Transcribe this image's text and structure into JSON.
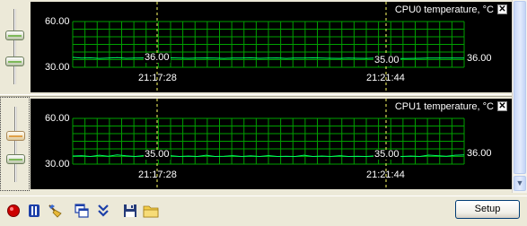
{
  "panels": [
    {
      "title": "CPU0 temperature, °C",
      "y_top": "60.00",
      "y_bottom": "30.00",
      "x_labels": [
        "21:17:28",
        "21:21:44"
      ],
      "cursor_values": [
        "36.00",
        "35.00"
      ],
      "last_value": "36.00",
      "close_glyph": "✕",
      "slider_values": [
        0.2,
        0.75
      ]
    },
    {
      "title": "CPU1 temperature, °C",
      "y_top": "60.00",
      "y_bottom": "30.00",
      "x_labels": [
        "21:17:28",
        "21:21:44"
      ],
      "cursor_values": [
        "35.00",
        "35.00"
      ],
      "last_value": "36.00",
      "close_glyph": "✕",
      "slider_values": [
        0.2,
        0.75
      ]
    }
  ],
  "toolbar": {
    "record_icon": "record-icon",
    "pause_icon": "pause-icon",
    "clear_icon": "broom-icon",
    "window_icon": "windows-icon",
    "collapse_icon": "double-chevron-down-icon",
    "save_icon": "floppy-disk-icon",
    "open_icon": "folder-icon",
    "setup_label": "Setup"
  },
  "colors": {
    "grid": "#00a000",
    "line": "#00ff66",
    "cursor": "#ffff66",
    "background": "#000000",
    "record": "#cc0000",
    "pause": "#1c3fa8"
  },
  "chart_data": [
    {
      "type": "line",
      "title": "CPU0 temperature, °C",
      "ylim": [
        30,
        60
      ],
      "x_tick_labels": [
        "21:17:28",
        "21:21:44"
      ],
      "series": [
        {
          "values": [
            36.5,
            36,
            36.2,
            35.8,
            36,
            36.3,
            35.9,
            36,
            36.1,
            35.8,
            36,
            36.2,
            36,
            35.9,
            36,
            36.1,
            36,
            35.8,
            36,
            36,
            36.2,
            35.9,
            36,
            36.1,
            35.8,
            36,
            36,
            36.2,
            36,
            35.9,
            35.8,
            36,
            35.9,
            35.8,
            36,
            35.9,
            35.8,
            35.7,
            35.8,
            35.9,
            36,
            36,
            36,
            36,
            36
          ]
        }
      ]
    },
    {
      "type": "line",
      "title": "CPU1 temperature, °C",
      "ylim": [
        30,
        60
      ],
      "x_tick_labels": [
        "21:17:28",
        "21:21:44"
      ],
      "series": [
        {
          "values": [
            35.3,
            35.5,
            35,
            35.8,
            35.2,
            36,
            35.4,
            35,
            35.6,
            35.2,
            35,
            35.5,
            35,
            35.3,
            35,
            35.8,
            35,
            35.2,
            35.5,
            35,
            35.4,
            35,
            35.6,
            35,
            35.2,
            35,
            35.8,
            35,
            35.3,
            35,
            35.5,
            35,
            35.2,
            35,
            35.4,
            35,
            35.6,
            35,
            35.3,
            35,
            35.9,
            35.5,
            35.2,
            35.8,
            36
          ]
        }
      ]
    }
  ]
}
